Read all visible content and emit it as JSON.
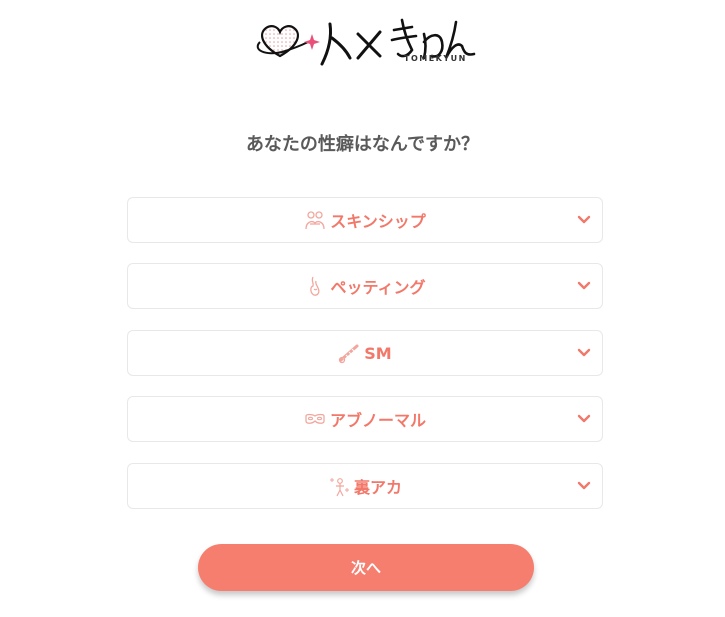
{
  "logo": {
    "text": "TOMEKYUN"
  },
  "question": "あなたの性癖はなんですか？",
  "categories": [
    {
      "label": "スキンシップ",
      "icon": "hug-icon"
    },
    {
      "label": "ペッティング",
      "icon": "finger-icon"
    },
    {
      "label": "SM",
      "icon": "rope-icon"
    },
    {
      "label": "アブノーマル",
      "icon": "mask-icon"
    },
    {
      "label": "裏アカ",
      "icon": "sparkle-person-icon"
    }
  ],
  "next_button": "次へ",
  "colors": {
    "accent": "#f57e6f",
    "label": "#f2786a",
    "text": "#5a5a5a"
  }
}
